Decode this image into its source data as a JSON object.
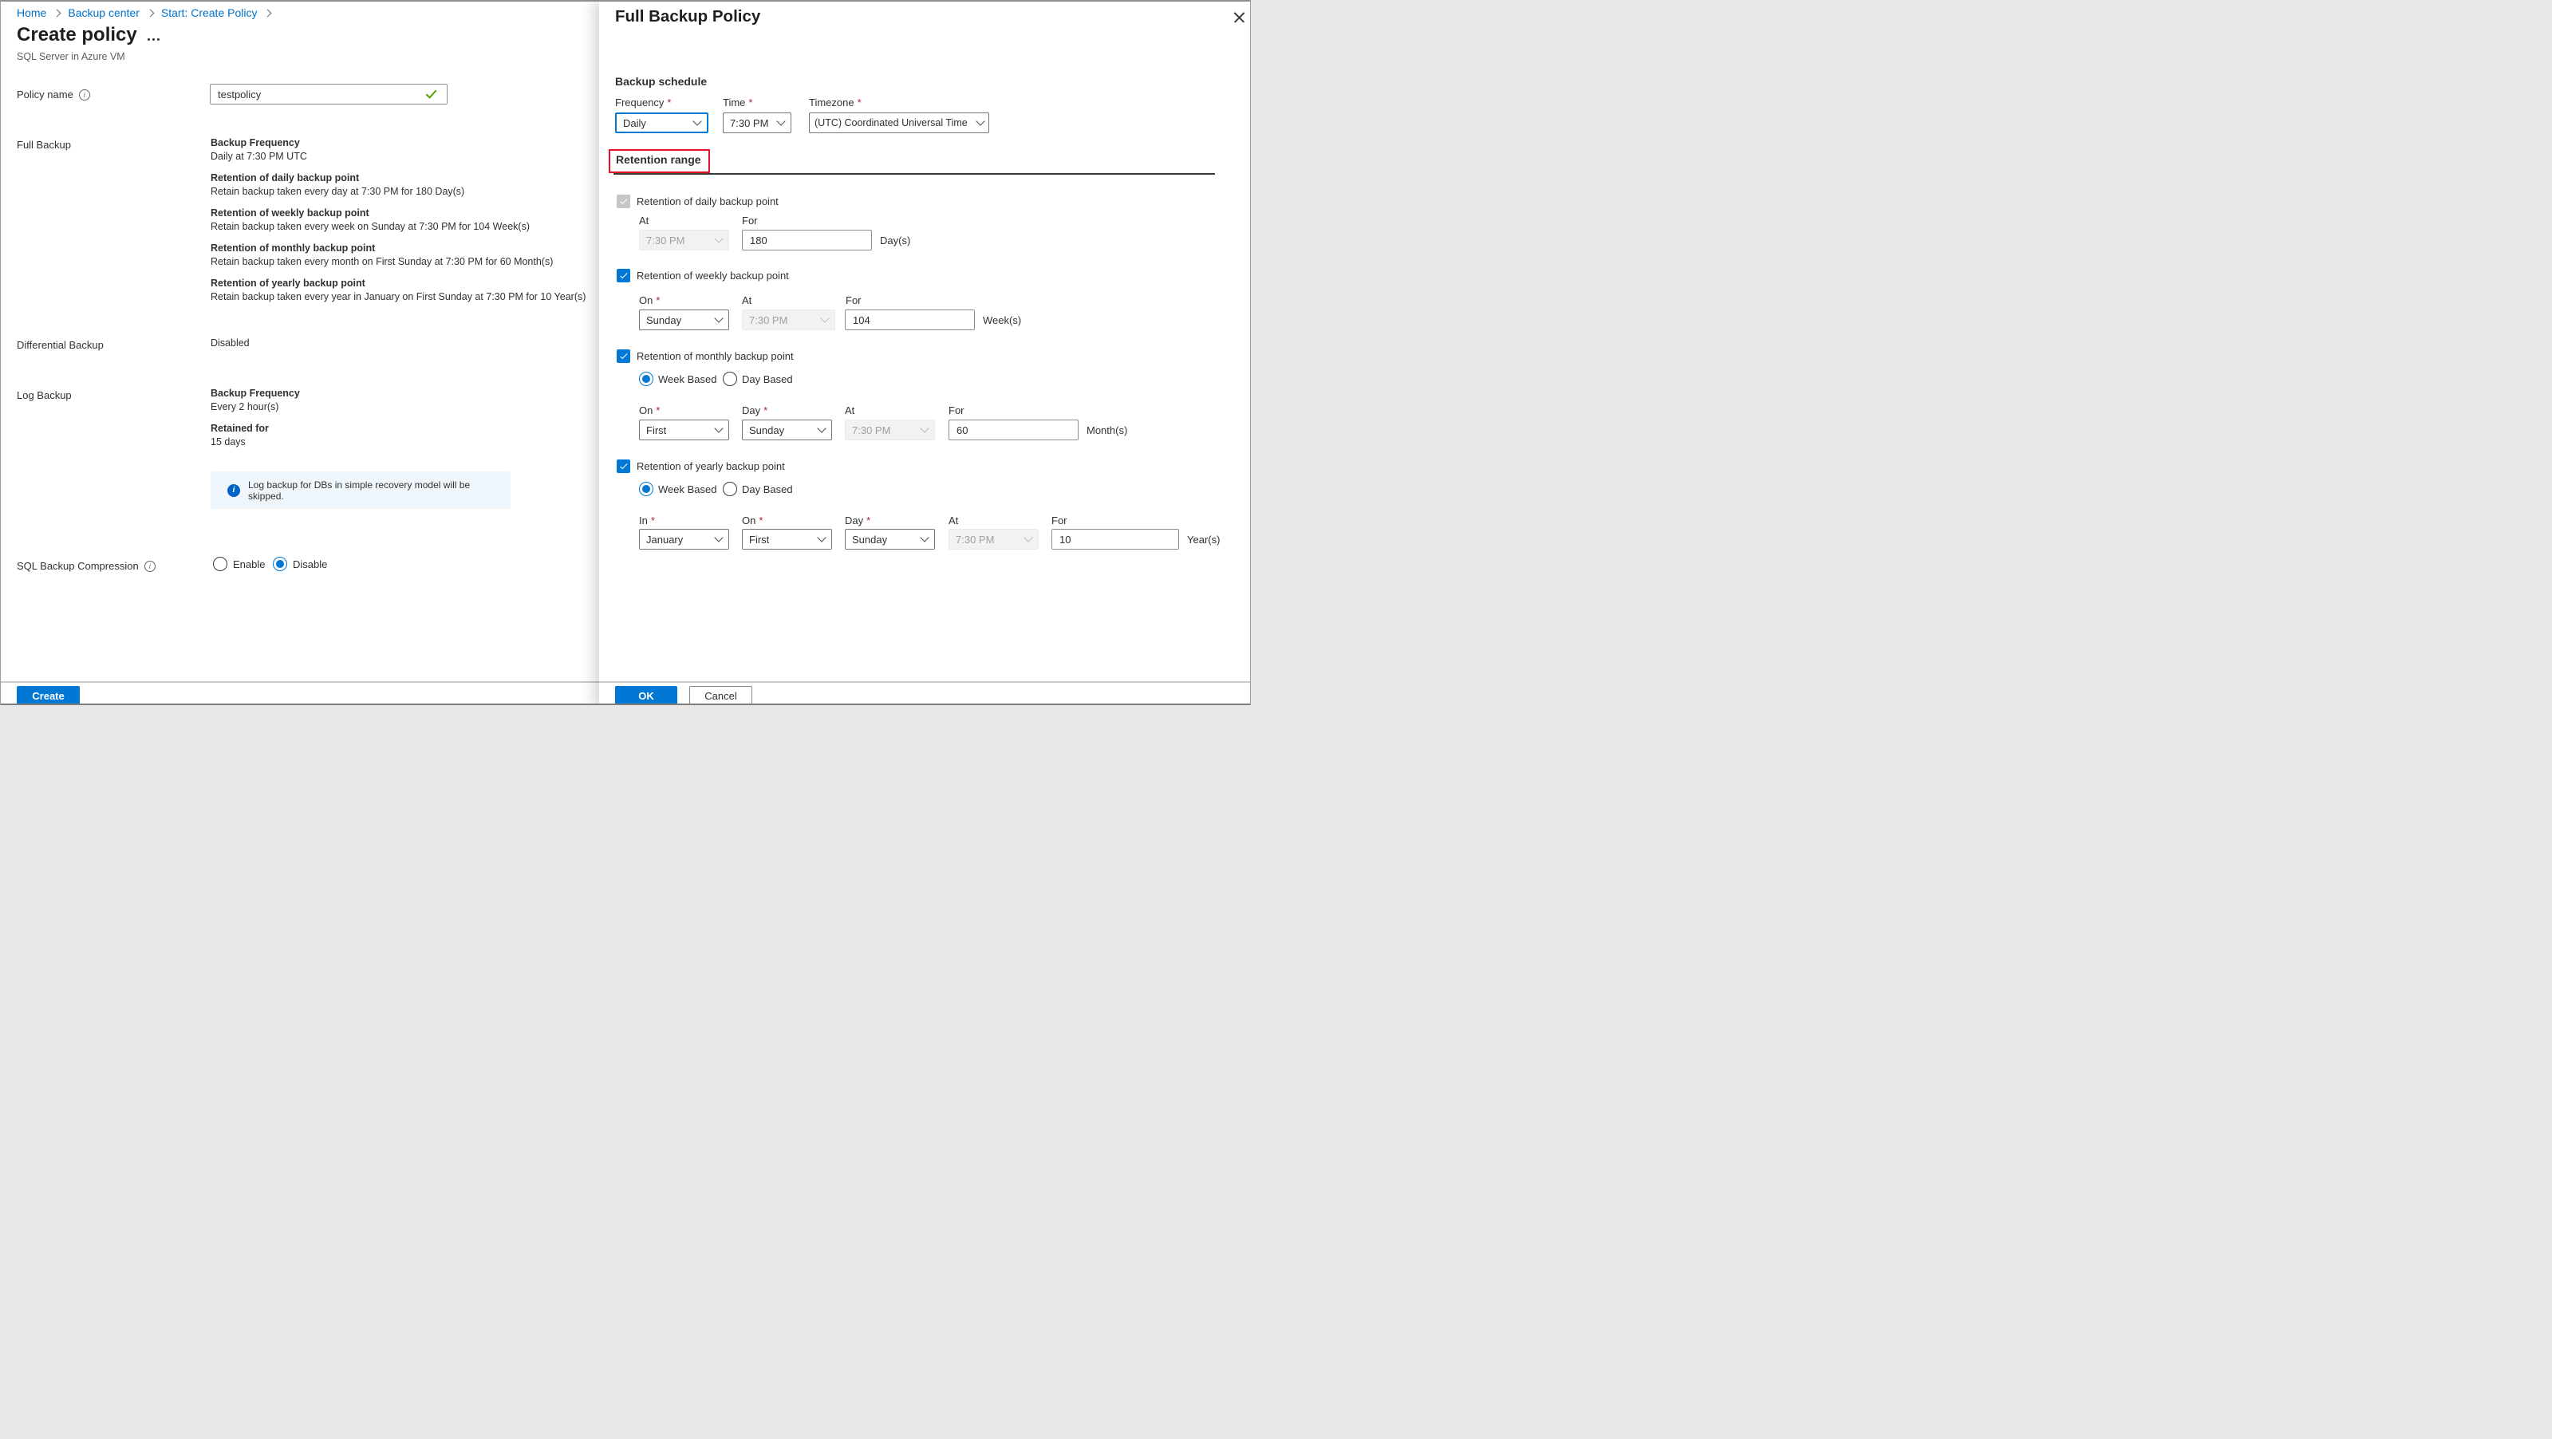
{
  "ui": {
    "required_marker": "*"
  },
  "icons": {
    "info": "i",
    "close": "x-cross",
    "more": "ellipsis-horizontal",
    "chevron": "chevron-down",
    "check": "checkmark"
  },
  "colors": {
    "accent": "#0078d4",
    "annotation_red": "#e81123",
    "valid_green": "#57a300",
    "info_banner_bg": "#eff6fc",
    "link_blue": "#0072c9"
  },
  "breadcrumb": {
    "items": [
      "Home",
      "Backup center",
      "Start: Create Policy"
    ]
  },
  "left_panel": {
    "title": "Create policy",
    "subtitle": "SQL Server in Azure VM",
    "policy_name": {
      "label": "Policy name",
      "value": "testpolicy"
    },
    "full_backup": {
      "label": "Full Backup",
      "groups": [
        {
          "heading": "Backup Frequency",
          "text": "Daily at 7:30 PM UTC"
        },
        {
          "heading": "Retention of daily backup point",
          "text": "Retain backup taken every day at 7:30 PM for 180 Day(s)"
        },
        {
          "heading": "Retention of weekly backup point",
          "text": "Retain backup taken every week on Sunday at 7:30 PM for 104 Week(s)"
        },
        {
          "heading": "Retention of monthly backup point",
          "text": "Retain backup taken every month on First Sunday at 7:30 PM for 60 Month(s)"
        },
        {
          "heading": "Retention of yearly backup point",
          "text": "Retain backup taken every year in January on First Sunday at 7:30 PM for 10 Year(s)"
        }
      ]
    },
    "differential_backup": {
      "label": "Differential Backup",
      "value": "Disabled"
    },
    "log_backup": {
      "label": "Log Backup",
      "groups": [
        {
          "heading": "Backup Frequency",
          "text": "Every 2 hour(s)"
        },
        {
          "heading": "Retained for",
          "text": "15 days"
        }
      ],
      "info": "Log backup for DBs in simple recovery model will be skipped."
    },
    "sql_compression": {
      "label": "SQL Backup Compression",
      "options": [
        {
          "label": "Enable",
          "selected": false
        },
        {
          "label": "Disable",
          "selected": true
        }
      ]
    },
    "create_button": "Create"
  },
  "panel": {
    "title": "Full Backup Policy",
    "schedule_heading": "Backup schedule",
    "frequency": {
      "label": "Frequency",
      "value": "Daily"
    },
    "time": {
      "label": "Time",
      "value": "7:30 PM"
    },
    "timezone": {
      "label": "Timezone",
      "value": "(UTC) Coordinated Universal Time"
    },
    "retention_heading": "Retention range",
    "daily": {
      "title": "Retention of daily backup point",
      "at_label": "At",
      "at_value": "7:30 PM",
      "for_label": "For",
      "for_value": "180",
      "unit": "Day(s)"
    },
    "weekly": {
      "title": "Retention of weekly backup point",
      "on_label": "On",
      "on_value": "Sunday",
      "at_label": "At",
      "at_value": "7:30 PM",
      "for_label": "For",
      "for_value": "104",
      "unit": "Week(s)"
    },
    "monthly": {
      "title": "Retention of monthly backup point",
      "week_based_label": "Week Based",
      "day_based_label": "Day Based",
      "on_label": "On",
      "on_value": "First",
      "day_label": "Day",
      "day_value": "Sunday",
      "at_label": "At",
      "at_value": "7:30 PM",
      "for_label": "For",
      "for_value": "60",
      "unit": "Month(s)"
    },
    "yearly": {
      "title": "Retention of yearly backup point",
      "week_based_label": "Week Based",
      "day_based_label": "Day Based",
      "in_label": "In",
      "in_value": "January",
      "on_label": "On",
      "on_value": "First",
      "day_label": "Day",
      "day_value": "Sunday",
      "at_label": "At",
      "at_value": "7:30 PM",
      "for_label": "For",
      "for_value": "10",
      "unit": "Year(s)"
    },
    "ok_button": "OK",
    "cancel_button": "Cancel"
  }
}
